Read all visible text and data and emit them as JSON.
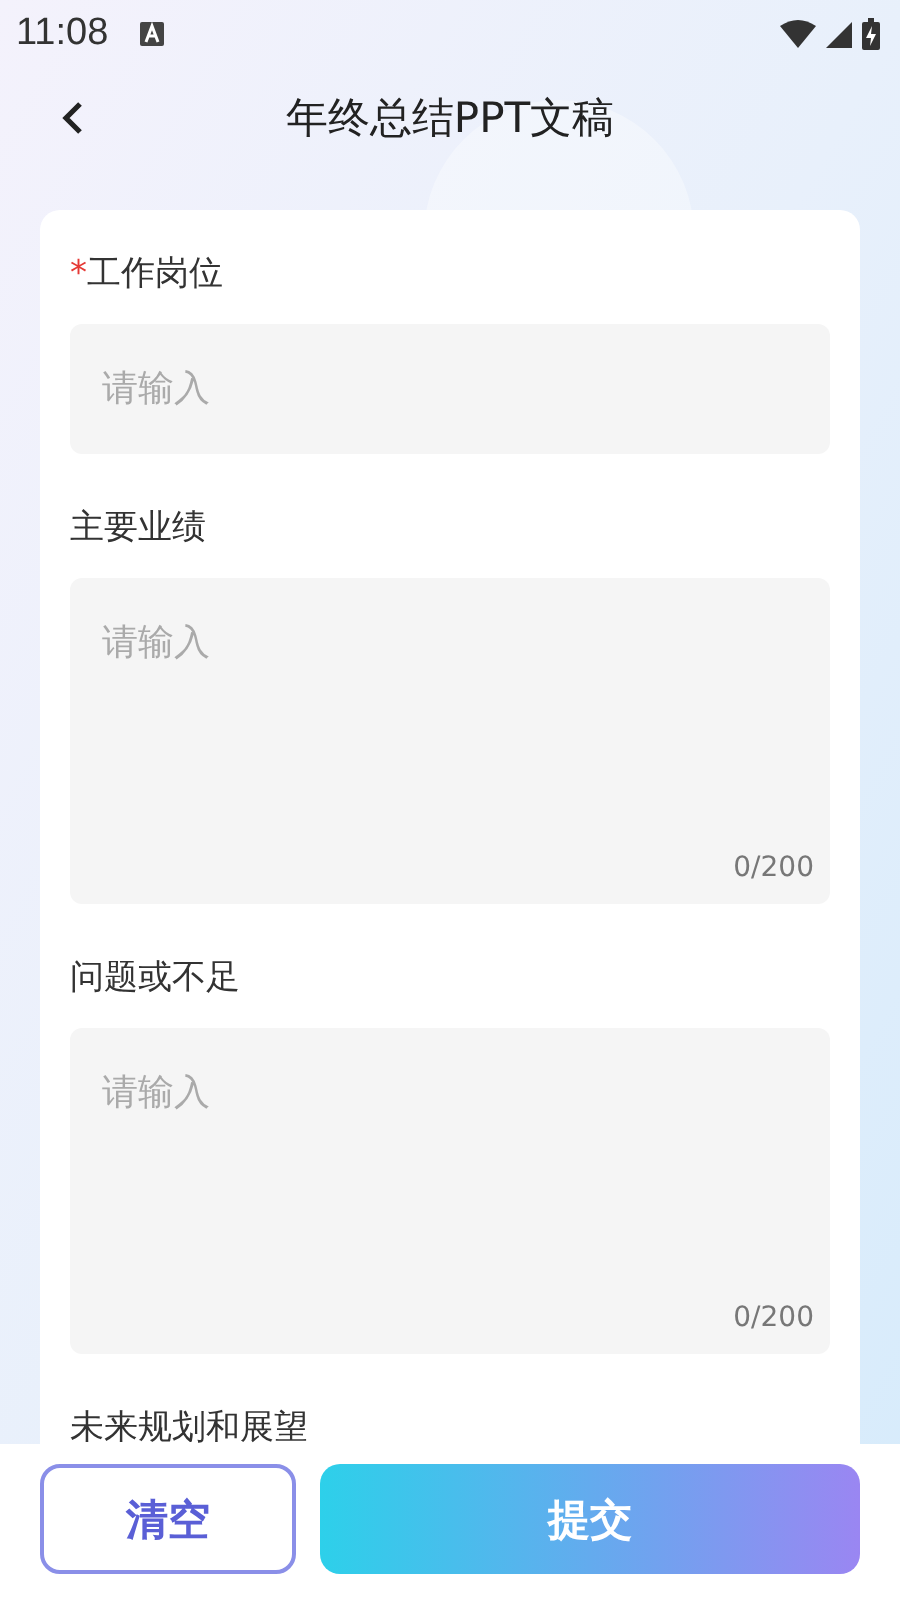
{
  "status_bar": {
    "time": "11:08"
  },
  "header": {
    "title": "年终总结PPT文稿"
  },
  "form": {
    "required_mark": "*",
    "fields": [
      {
        "kind": "input",
        "label": "工作岗位",
        "required": true,
        "placeholder": "请输入"
      },
      {
        "kind": "textarea",
        "label": "主要业绩",
        "required": false,
        "placeholder": "请输入",
        "counter": "0/200"
      },
      {
        "kind": "textarea",
        "label": "问题或不足",
        "required": false,
        "placeholder": "请输入",
        "counter": "0/200"
      },
      {
        "kind": "label",
        "label": "未来规划和展望",
        "required": false
      }
    ]
  },
  "actions": {
    "clear": "清空",
    "submit": "提交"
  }
}
